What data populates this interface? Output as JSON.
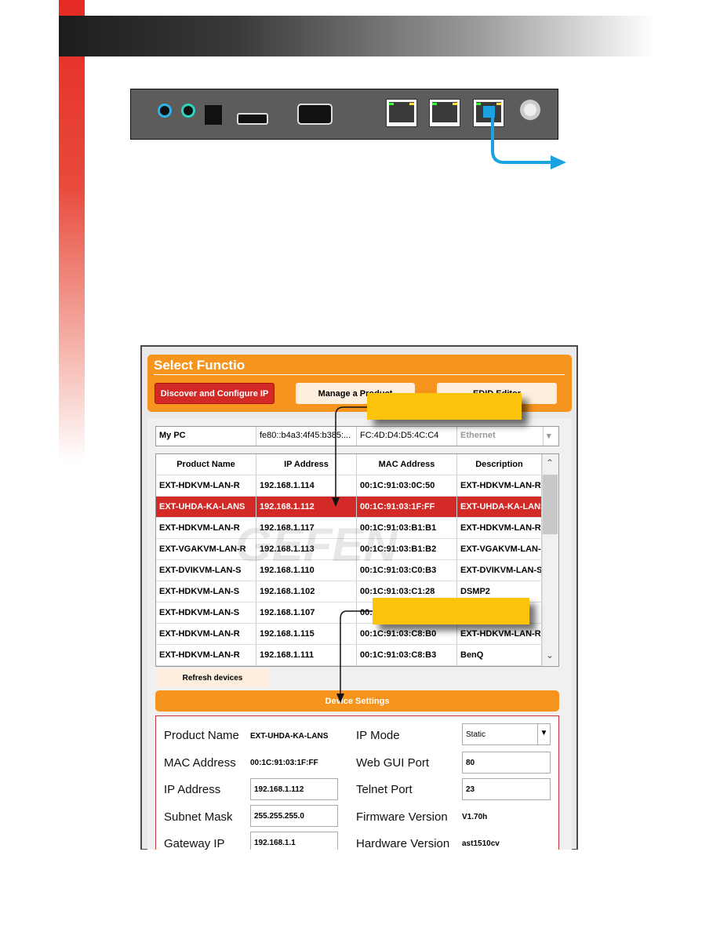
{
  "colors": {
    "accent_red": "#e52a25",
    "orange": "#f7941d",
    "callout_yellow": "#fbc40a",
    "cable_blue": "#1aa3e0",
    "selected_row": "#d42a27"
  },
  "app": {
    "title": "Select Functio",
    "buttons": {
      "discover": "Discover and Configure IP",
      "manage": "Manage a Product",
      "edid": "EDID Editor"
    },
    "mypc": {
      "name": "My PC",
      "ipv6": "fe80::b4a3:4f45:b385:...",
      "mac": "FC:4D:D4:D5:4C:C4",
      "adapter": "Ethernet"
    },
    "table": {
      "headers": [
        "Product Name",
        "IP Address",
        "MAC Address",
        "Description"
      ],
      "rows": [
        [
          "EXT-HDKVM-LAN-R",
          "192.168.1.114",
          "00:1C:91:03:0C:50",
          "EXT-HDKVM-LAN-R"
        ],
        [
          "EXT-UHDA-KA-LANS",
          "192.168.1.112",
          "00:1C:91:03:1F:FF",
          "EXT-UHDA-KA-LANS"
        ],
        [
          "EXT-HDKVM-LAN-R",
          "192.168.1.117",
          "00:1C:91:03:B1:B1",
          "EXT-HDKVM-LAN-R"
        ],
        [
          "EXT-VGAKVM-LAN-R",
          "192.168.1.113",
          "00:1C:91:03:B1:B2",
          "EXT-VGAKVM-LAN-R"
        ],
        [
          "EXT-DVIKVM-LAN-S",
          "192.168.1.110",
          "00:1C:91:03:C0:B3",
          "EXT-DVIKVM-LAN-S"
        ],
        [
          "EXT-HDKVM-LAN-S",
          "192.168.1.102",
          "00:1C:91:03:C1:28",
          "DSMP2"
        ],
        [
          "EXT-HDKVM-LAN-S",
          "192.168.1.107",
          "00:",
          "",
          ""
        ],
        [
          "EXT-HDKVM-LAN-R",
          "192.168.1.115",
          "00:1C:91:03:C8:B0",
          "EXT-HDKVM-LAN-R"
        ],
        [
          "EXT-HDKVM-LAN-R",
          "192.168.1.111",
          "00:1C:91:03:C8:B3",
          "BenQ"
        ]
      ],
      "selected_row": 1
    },
    "refresh": "Refresh devices",
    "device_settings": {
      "title": "Device Settings",
      "product_name_label": "Product Name",
      "product_name": "EXT-UHDA-KA-LANS",
      "mac_label": "MAC Address",
      "mac": "00:1C:91:03:1F:FF",
      "ip_label": "IP Address",
      "ip": "192.168.1.112",
      "subnet_label": "Subnet Mask",
      "subnet": "255.255.255.0",
      "gateway_label": "Gateway IP",
      "gateway": "192.168.1.1",
      "ipmode_label": "IP Mode",
      "ipmode": "Static",
      "webgui_label": "Web GUI Port",
      "webgui": "80",
      "telnet_label": "Telnet Port",
      "telnet": "23",
      "firmware_label": "Firmware Version",
      "firmware": "V1.70h",
      "hardware_label": "Hardware Version",
      "hardware": "ast1510cv"
    }
  },
  "watermark": {
    "logo": "GEFEN SYNER-G"
  }
}
